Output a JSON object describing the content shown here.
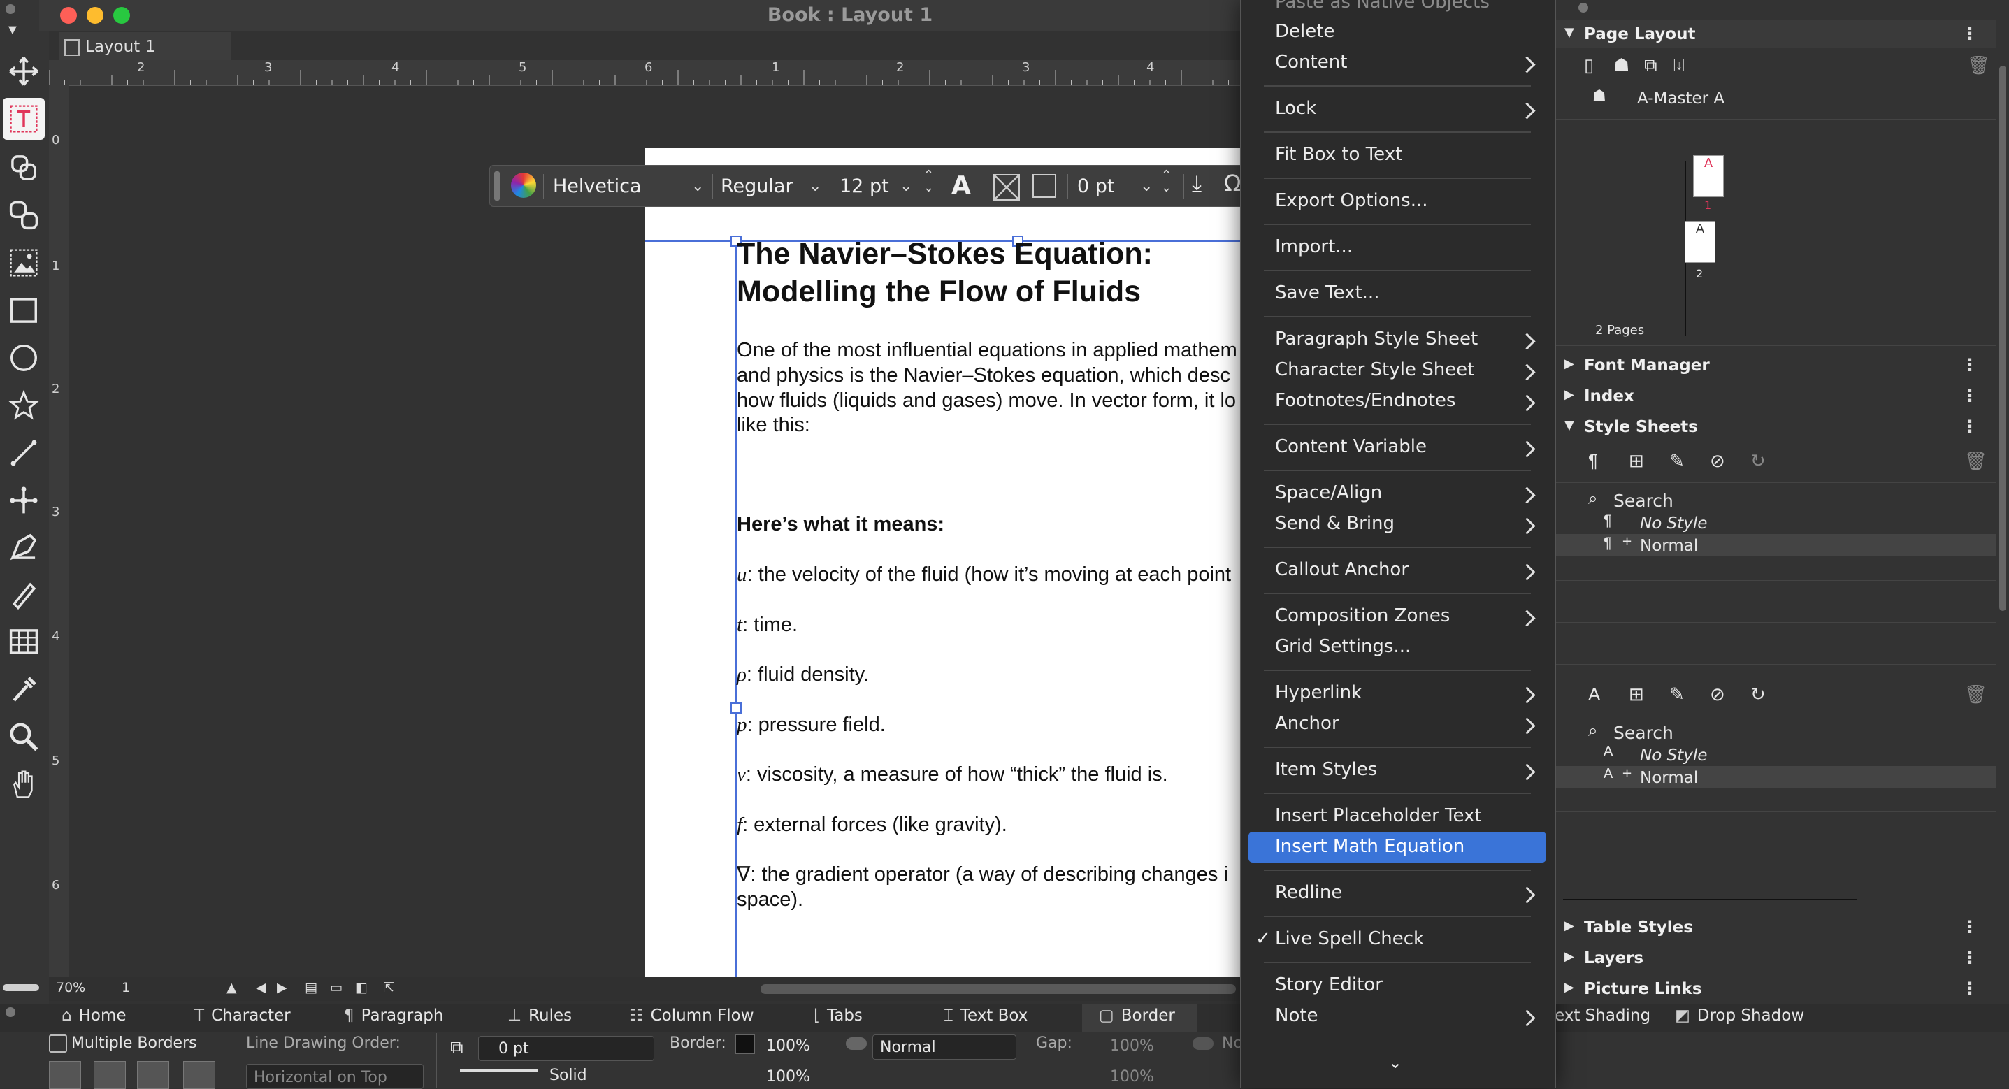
{
  "window": {
    "title": "Book : Layout 1",
    "layout_tab": "Layout 1",
    "traffic_lights": {
      "close": "#fe5f57",
      "minimize": "#febc2e",
      "zoom": "#28c840"
    }
  },
  "tools": [
    "move-tool-icon",
    "text-content-tool-icon",
    "linking-tool-icon",
    "unlinking-tool-icon",
    "picture-content-tool-icon",
    "rectangle-box-tool-icon",
    "oval-box-tool-icon",
    "star-box-tool-icon",
    "line-tool-icon",
    "pen-tool-icon",
    "select-point-tool-icon",
    "freehand-pen-icon",
    "table-tool-icon",
    "eyedropper-icon",
    "zoom-tool-icon",
    "pan-hand-icon"
  ],
  "ruler": {
    "top_numbers": [
      "2",
      "3",
      "4",
      "5",
      "6",
      "1",
      "2",
      "3",
      "4"
    ],
    "left_numbers": [
      "0",
      "1",
      "2",
      "3",
      "4",
      "5",
      "6"
    ]
  },
  "text_toolbar": {
    "font": "Helvetica",
    "style": "Regular",
    "size": "12 pt",
    "stroke": "0 pt"
  },
  "document": {
    "title_line1": "The Navier–Stokes Equation:",
    "title_line2": "Modelling the Flow of Fluids",
    "intro": [
      "One of the most influential equations in applied mathem",
      "and physics is the Navier–Stokes equation, which desc",
      "how fluids (liquids and gases) move. In vector form, it lo",
      "like this:"
    ],
    "heading": "Here’s what it means:",
    "terms": [
      {
        "sym": "u",
        "text": ": the velocity of the fluid (how it’s moving at each point"
      },
      {
        "sym": "t",
        "text": ": time."
      },
      {
        "sym": "ρ",
        "text": ": fluid density."
      },
      {
        "sym": "p",
        "text": ": pressure field."
      },
      {
        "sym": "ν",
        "text": ": viscosity, a measure of how “thick” the fluid is."
      },
      {
        "sym": "f",
        "text": ": external forces (like gravity)."
      },
      {
        "sym": "∇",
        "text": ": the gradient operator (a way of describing changes i"
      }
    ],
    "term_last_cont": "space)."
  },
  "status": {
    "zoom": "70%",
    "page": "1"
  },
  "context_menu": {
    "items_top": [
      "Paste as Native Objects",
      "Delete",
      "Content"
    ],
    "lock": "Lock",
    "fit_box": "Fit Box to Text",
    "export_options": "Export Options...",
    "import": "Import...",
    "save_text": "Save Text...",
    "paragraph_style_sheet": "Paragraph Style Sheet",
    "character_style_sheet": "Character Style Sheet",
    "footnotes": "Footnotes/Endnotes",
    "content_variable": "Content Variable",
    "space_align": "Space/Align",
    "send_bring": "Send & Bring",
    "callout_anchor": "Callout Anchor",
    "composition_zones": "Composition Zones",
    "grid_settings": "Grid Settings...",
    "hyperlink": "Hyperlink",
    "anchor": "Anchor",
    "item_styles": "Item Styles",
    "insert_placeholder": "Insert Placeholder Text",
    "insert_math": "Insert Math Equation",
    "redline": "Redline",
    "live_spell_check": "Live Spell Check",
    "checkmark": "✓",
    "story_editor": "Story Editor",
    "note": "Note",
    "highlight_color": "#3a74d8"
  },
  "right_panel": {
    "page_layout": "Page Layout",
    "master": "A-Master A",
    "thumb_letter": "A",
    "page_num_1": "1",
    "page_num_2": "2",
    "pages_count": "2 Pages",
    "font_manager": "Font Manager",
    "index": "Index",
    "style_sheets": "Style Sheets",
    "search": "Search",
    "no_style": "No Style",
    "normal": "Normal",
    "table_styles": "Table Styles",
    "layers": "Layers",
    "picture_links": "Picture Links"
  },
  "measurements": {
    "tabs": [
      "Home",
      "Character",
      "Paragraph",
      "Rules",
      "Column Flow",
      "Tabs",
      "Text Box",
      "Border"
    ],
    "right_tabs": [
      "ext Shading",
      "Drop Shadow"
    ],
    "multiple_borders": "Multiple Borders",
    "line_drawing_order": "Line Drawing Order:",
    "horizontal_on_top": "Horizontal on Top",
    "offset": "0 pt",
    "border_label": "Border:",
    "opacity1": "100%",
    "opacity2": "100%",
    "blend": "Normal",
    "gap_label": "Gap:",
    "gap_opacity1": "100%",
    "gap_opacity2": "100%",
    "solid": "Solid",
    "none_abbrev": "No"
  }
}
